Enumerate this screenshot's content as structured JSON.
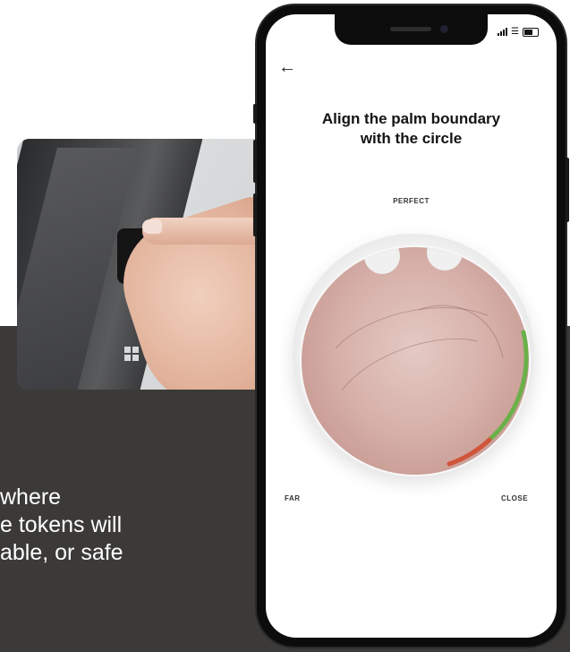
{
  "background_text": {
    "lines": [
      "where",
      "e tokens will",
      "able, or safe"
    ]
  },
  "app": {
    "back_icon": "arrow-left-icon",
    "title_line1": "Align the palm boundary",
    "title_line2": "with the circle",
    "label_perfect": "PERFECT",
    "label_far": "FAR",
    "label_close": "CLOSE",
    "progress_color": "#6cb04a",
    "warning_color": "#d0553a"
  },
  "colors": {
    "dark_panel": "#3b3a38",
    "phone_frame": "#0c0c0c"
  }
}
